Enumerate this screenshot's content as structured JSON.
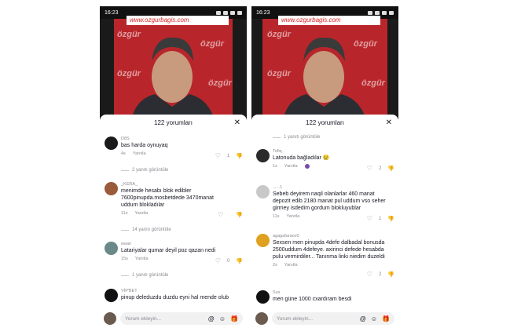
{
  "left": {
    "time": "16:23",
    "brand": "www.ozgurbagis.com",
    "watermark": "özgür",
    "header": "122 yorumları",
    "comments": [
      {
        "user": "D8S",
        "text": "bas harda oynuyaq",
        "time": "4s",
        "reply": "Yanıtla",
        "likes": "1",
        "replies": "2 yanıtı görüntüle",
        "avatar": "#1a1a1a"
      },
      {
        "user": "_KERA_",
        "text": "menimde hesabı blok edibler 7600pinupda.mosbetdede 3470manat uddum blokladılar",
        "time": "11s",
        "reply": "Yanıtla",
        "likes": "",
        "replies": "14 yanıtı görüntüle",
        "avatar": "#9a5b3a"
      },
      {
        "user": "ewan",
        "text": "Latariyalar qumar deyil poz qazan nedi",
        "time": "15s",
        "reply": "Yanıtla",
        "likes": "0",
        "replies": "1 yanıtı görüntüle",
        "avatar": "#6a8a8a"
      },
      {
        "user": "VİP'BET",
        "text": "pinup deleduzdu duzdu eyni hal mende olub",
        "time": "",
        "reply": "",
        "likes": "",
        "replies": "",
        "avatar": "#111111"
      }
    ],
    "input_placeholder": "Yorum ekleyin..."
  },
  "right": {
    "time": "16:23",
    "brand": "www.ozgurbagis.com",
    "watermark": "özgür",
    "header": "122 yorumları",
    "top_replies": "1 yanıtı görüntüle",
    "comments": [
      {
        "user": "Tofiq . ",
        "text": "Latonuda bağladılar 😢",
        "time": "1s",
        "reply": "Yanıtla",
        "likes": "2",
        "replies": "",
        "avatar": "#2a2a2a"
      },
      {
        "user": "......1",
        "text": "Sebeb deyirem naqil olanlarlar 460 manat depozit edib 2180 manat pul uddum vso seher girmey isdedim gordum blokluyublar",
        "time": "11s",
        "reply": "Yanıtla",
        "likes": "1",
        "replies": "",
        "avatar": "#c8c8c8"
      },
      {
        "user": "agagafaraov0",
        "text": "Sexsen men pinupda 4defe dalbadal bonusda 2500uddum 4defeye. axirinci defede hesabda pulu vermirdiler... Tanınma linki niedim duzeldi",
        "time": "2s",
        "reply": "Yanıtla",
        "likes": "2",
        "replies": "",
        "avatar": "#e0a020"
      },
      {
        "user": "Sus",
        "text": "men güne 1000 cxardıram besdi",
        "time": "",
        "reply": "",
        "likes": "",
        "replies": "",
        "avatar": "#111111"
      }
    ],
    "input_placeholder": "Yorum ekleyin..."
  },
  "icons": {
    "mention": "@",
    "emoji": "☺",
    "gift": "🎁",
    "heart": "♡",
    "dislike": "👎",
    "close": "✕"
  }
}
